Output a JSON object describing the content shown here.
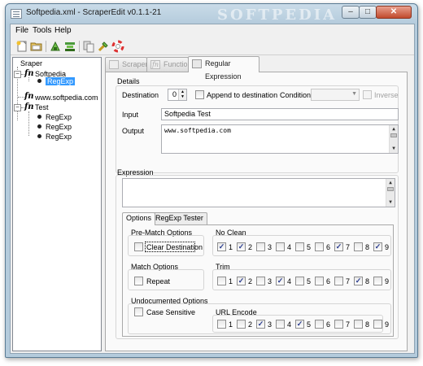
{
  "window": {
    "title": "Softpedia.xml - ScraperEdit v0.1.1-21",
    "watermark": "SOFTPEDIA",
    "minimize": "–",
    "maximize": "□",
    "close": "✕"
  },
  "menu": {
    "file": "File",
    "tools": "Tools",
    "help": "Help"
  },
  "toolbar": {
    "icons": [
      "new-file-icon",
      "open-folder-icon",
      "scraper-icon-1",
      "scraper-icon-2",
      "copy-icon",
      "run-icon",
      "help-lifebuoy-icon"
    ]
  },
  "tree": {
    "root": "Sraper",
    "fn_glyph": "fn",
    "softpedia": "Softpedia",
    "softpedia_child": "RegExp",
    "url": "www.softpedia.com",
    "test": "Test",
    "test_children": [
      "RegExp",
      "RegExp",
      "RegExp"
    ],
    "expand_glyph": "−"
  },
  "tabs": {
    "scraper": "Scraper",
    "function": "Function",
    "regex": "Regular Expression"
  },
  "details": {
    "group": "Details",
    "destination_label": "Destination",
    "destination_value": "0",
    "append_label": "Append to destination",
    "condition_label": "Condition",
    "inverse_label": "Inverse",
    "input_label": "Input",
    "input_value": "Softpedia Test",
    "output_label": "Output",
    "output_value": "www.softpedia.com"
  },
  "expression": {
    "label": "Expression",
    "value": ""
  },
  "subtabs": {
    "options": "Options",
    "tester": "RegExp Tester"
  },
  "options": {
    "prematch_title": "Pre-Match Options",
    "clear_destination": "Clear Destination",
    "noclean_title": "No Clean",
    "match_title": "Match Options",
    "repeat": "Repeat",
    "trim_title": "Trim",
    "undocumented_title": "Undocumented Options",
    "case_sensitive": "Case Sensitive",
    "urlencode_title": "URL Encode",
    "numbers": [
      "1",
      "2",
      "3",
      "4",
      "5",
      "6",
      "7",
      "8",
      "9"
    ],
    "noclean_checked": [
      true,
      true,
      false,
      false,
      false,
      false,
      true,
      false,
      true
    ],
    "trim_checked": [
      false,
      true,
      false,
      true,
      false,
      false,
      false,
      true,
      false
    ],
    "urlencode_checked": [
      false,
      false,
      true,
      false,
      true,
      false,
      false,
      false,
      false
    ],
    "check_glyph": "✓"
  }
}
